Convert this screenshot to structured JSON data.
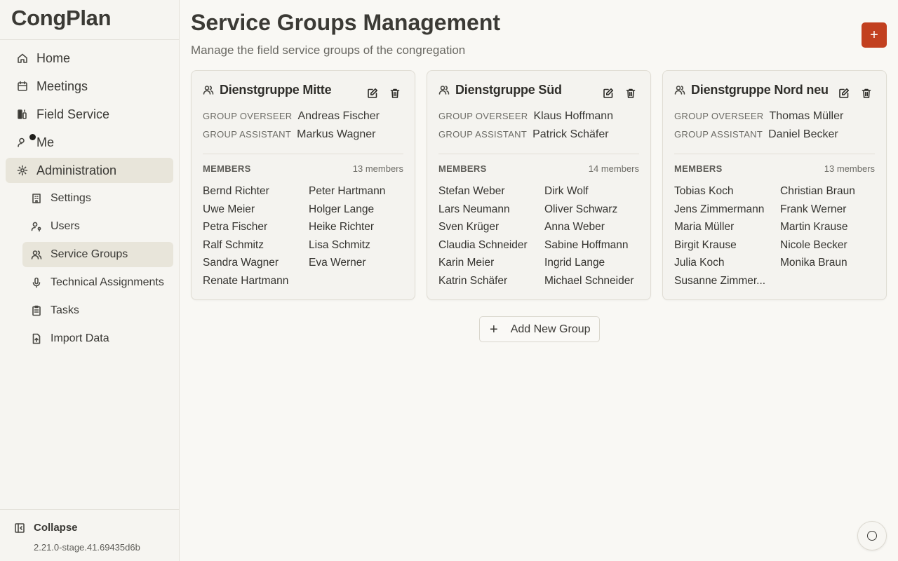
{
  "app": {
    "name": "CongPlan",
    "version": "2.21.0-stage.41.69435d6b"
  },
  "sidebar": {
    "items": [
      {
        "label": "Home",
        "icon": "home-icon"
      },
      {
        "label": "Meetings",
        "icon": "calendar-icon"
      },
      {
        "label": "Field Service",
        "icon": "field-service-icon"
      },
      {
        "label": "Me",
        "icon": "user-icon"
      },
      {
        "label": "Administration",
        "icon": "gear-icon"
      }
    ],
    "sub_items": [
      {
        "label": "Settings",
        "icon": "building-icon"
      },
      {
        "label": "Users",
        "icon": "user-key-icon"
      },
      {
        "label": "Service Groups",
        "icon": "users-icon"
      },
      {
        "label": "Technical Assignments",
        "icon": "microphone-icon"
      },
      {
        "label": "Tasks",
        "icon": "clipboard-icon"
      },
      {
        "label": "Import Data",
        "icon": "file-import-icon"
      }
    ],
    "collapse_label": "Collapse"
  },
  "main": {
    "title": "Service Groups Management",
    "subtitle": "Manage the field service groups of the congregation",
    "add_button": "+",
    "add_group_label": "Add New Group",
    "labels": {
      "overseer": "GROUP OVERSEER",
      "assistant": "GROUP ASSISTANT",
      "members": "MEMBERS"
    },
    "groups": [
      {
        "name": "Dienstgruppe Mitte",
        "overseer": "Andreas Fischer",
        "assistant": "Markus Wagner",
        "member_count": "13 members",
        "members": [
          "Bernd Richter",
          "Peter Hartmann",
          "Uwe Meier",
          "Holger Lange",
          "Petra Fischer",
          "Heike Richter",
          "Ralf Schmitz",
          "Lisa Schmitz",
          "Sandra Wagner",
          "Eva Werner",
          "Renate Hartmann"
        ]
      },
      {
        "name": "Dienstgruppe Süd",
        "overseer": "Klaus Hoffmann",
        "assistant": "Patrick Schäfer",
        "member_count": "14 members",
        "members": [
          "Stefan Weber",
          "Dirk Wolf",
          "Lars Neumann",
          "Oliver Schwarz",
          "Sven Krüger",
          "Anna Weber",
          "Claudia Schneider",
          "Sabine Hoffmann",
          "Karin Meier",
          "Ingrid Lange",
          "Katrin Schäfer",
          "Michael Schneider"
        ]
      },
      {
        "name": "Dienstgruppe Nord neu",
        "overseer": "Thomas Müller",
        "assistant": "Daniel Becker",
        "member_count": "13 members",
        "members": [
          "Tobias Koch",
          "Christian Braun",
          "Jens Zimmermann",
          "Frank Werner",
          "Maria Müller",
          "Martin Krause",
          "Birgit Krause",
          "Nicole Becker",
          "Julia Koch",
          "Monika Braun",
          "Susanne Zimmer..."
        ]
      }
    ]
  },
  "colors": {
    "accent": "#c2401f",
    "active_bg": "#e8e5da",
    "background": "#f9f8f4"
  }
}
